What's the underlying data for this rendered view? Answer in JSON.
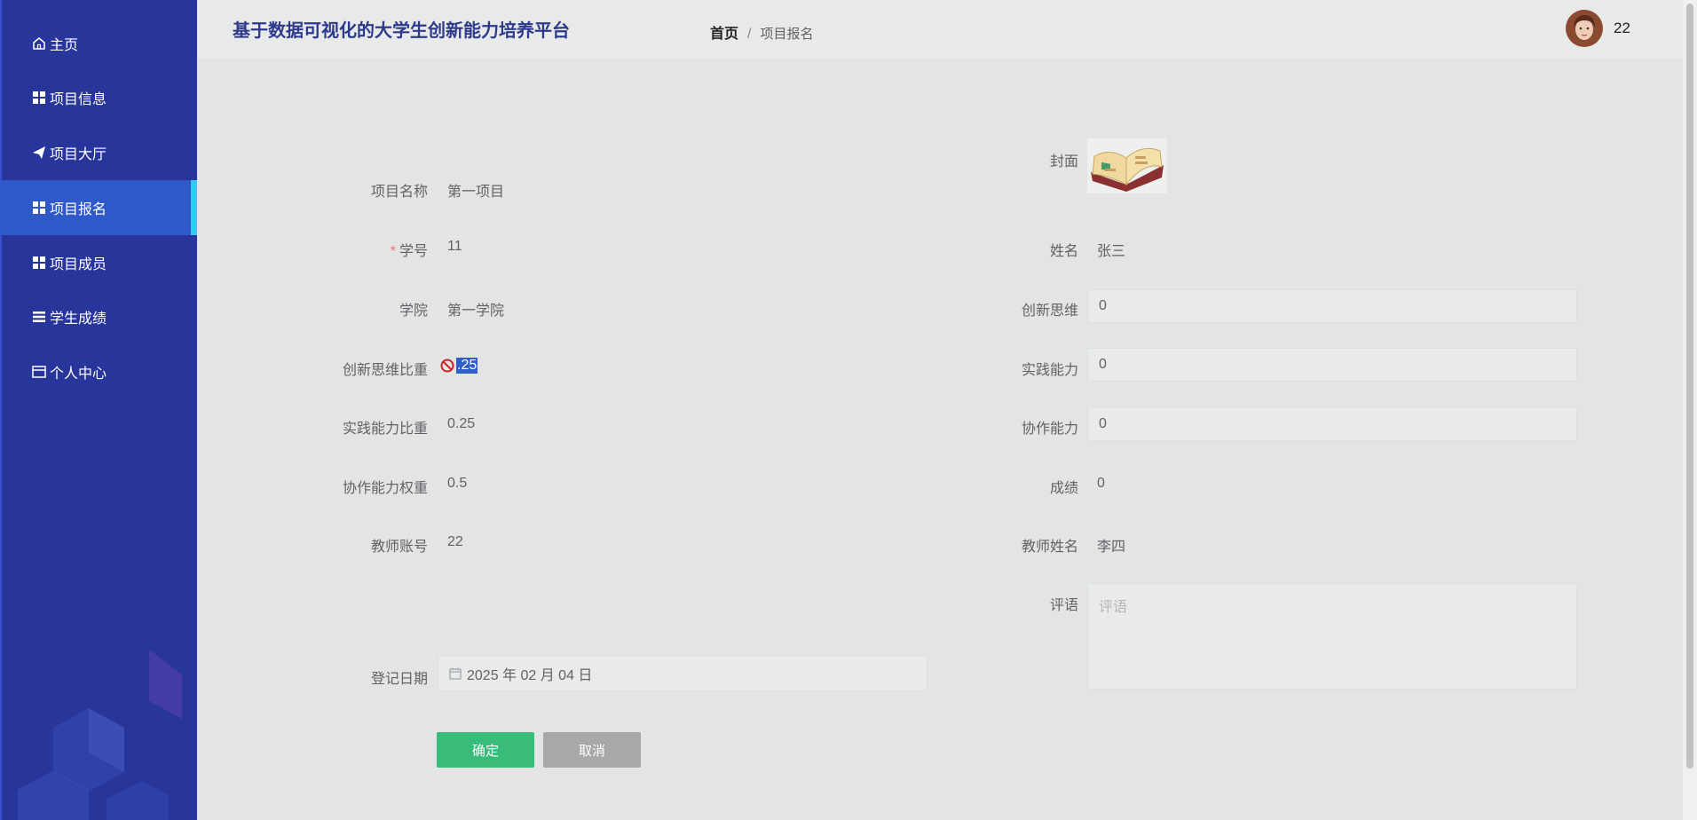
{
  "app": {
    "title": "基于数据可视化的大学生创新能力培养平台"
  },
  "breadcrumb": {
    "home": "首页",
    "separator": "/",
    "current": "项目报名"
  },
  "user": {
    "name": "22",
    "avatar_icon": "user-avatar"
  },
  "sidebar": {
    "items": [
      {
        "label": "主页",
        "icon": "home-icon"
      },
      {
        "label": "项目信息",
        "icon": "grid-icon"
      },
      {
        "label": "项目大厅",
        "icon": "send-icon"
      },
      {
        "label": "项目报名",
        "icon": "grid-icon",
        "active": true
      },
      {
        "label": "项目成员",
        "icon": "grid-icon"
      },
      {
        "label": "学生成绩",
        "icon": "list-icon"
      },
      {
        "label": "个人中心",
        "icon": "card-icon"
      }
    ]
  },
  "form": {
    "project_name": {
      "label": "项目名称",
      "value": "第一项目"
    },
    "cover": {
      "label": "封面",
      "image": "book-image"
    },
    "student_id": {
      "label": "学号",
      "value": "11",
      "required_mark": "*"
    },
    "name": {
      "label": "姓名",
      "value": "张三"
    },
    "college": {
      "label": "学院",
      "value": "第一学院"
    },
    "innovation": {
      "label": "创新思维",
      "value": "0"
    },
    "innovation_weight": {
      "label": "创新思维比重",
      "value": ".25",
      "icon": "not-allowed-icon"
    },
    "practice": {
      "label": "实践能力",
      "value": "0"
    },
    "practice_weight": {
      "label": "实践能力比重",
      "value": "0.25"
    },
    "collaboration": {
      "label": "协作能力",
      "value": "0"
    },
    "collaboration_weight": {
      "label": "协作能力权重",
      "value": "0.5"
    },
    "score": {
      "label": "成绩",
      "value": "0"
    },
    "teacher_account": {
      "label": "教师账号",
      "value": "22"
    },
    "teacher_name": {
      "label": "教师姓名",
      "value": "李四"
    },
    "comment": {
      "label": "评语",
      "placeholder": "评语"
    },
    "register_date": {
      "label": "登记日期",
      "value": "2025 年 02 月 04 日",
      "icon": "calendar-icon"
    }
  },
  "buttons": {
    "confirm": "确定",
    "cancel": "取消"
  },
  "colors": {
    "sidebar": "#28369b",
    "active": "#2f59c9",
    "accent": "#35c9ee",
    "confirm": "#39bc79",
    "cancel": "#a7a8a9"
  }
}
